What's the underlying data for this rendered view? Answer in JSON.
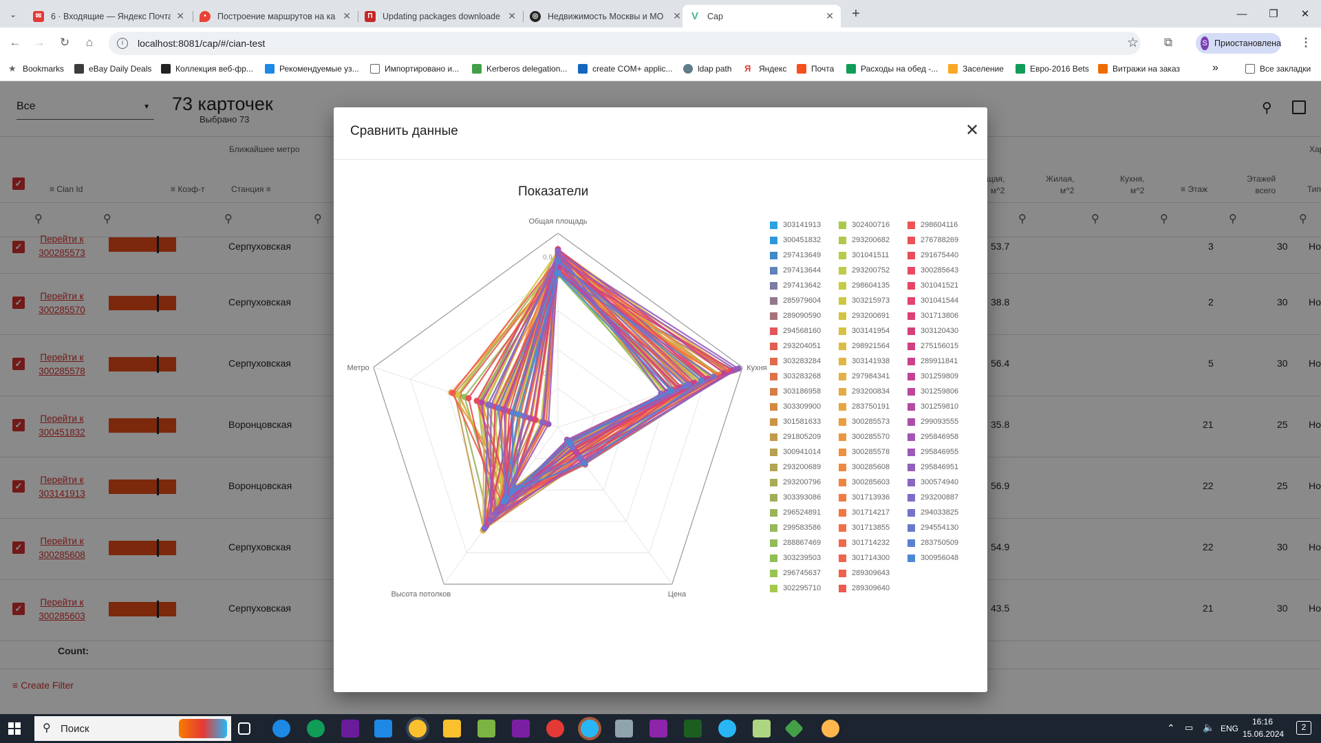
{
  "browser": {
    "tabs": [
      {
        "title": "6 · Входящие — Яндекс Почта",
        "icon": "mail-icon",
        "color": "#e53935"
      },
      {
        "title": "Построение маршрутов на ка",
        "icon": "map-pin-icon",
        "color": "#ea4335"
      },
      {
        "title": "Updating packages downloade",
        "icon": "page-icon",
        "color": "#c62828"
      },
      {
        "title": "Недвижимость Москвы и МО",
        "icon": "globe-icon",
        "color": "#222222"
      },
      {
        "title": "Cap",
        "icon": "vue-icon",
        "color": "#41b883"
      }
    ],
    "new_tab": "+",
    "url": "localhost:8081/cap/#/cian-test",
    "profile_initial": "S",
    "profile_label": "Приостановлена",
    "bookmarks": [
      {
        "label": "Bookmarks",
        "color": "#5f6368"
      },
      {
        "label": "eBay Daily Deals",
        "color": "#3c3c3c"
      },
      {
        "label": "Коллекция веб-фр...",
        "color": "#222222"
      },
      {
        "label": "Рекомендуемые уз...",
        "color": "#1e88e5"
      },
      {
        "label": "Импортировано и...",
        "color": "#5f6368"
      },
      {
        "label": "Kerberos delegation...",
        "color": "#43a047"
      },
      {
        "label": "create COM+ applic...",
        "color": "#1565c0"
      },
      {
        "label": "ldap path",
        "color": "#607d8b"
      },
      {
        "label": "Яндекс",
        "color": "#e53935"
      },
      {
        "label": "Почта",
        "color": "#f4511e"
      },
      {
        "label": "Расходы на обед -...",
        "color": "#0f9d58"
      },
      {
        "label": "Заселение",
        "color": "#f9a825"
      },
      {
        "label": "Евро-2016 Bets",
        "color": "#0f9d58"
      },
      {
        "label": "Витражи на заказ",
        "color": "#ef6c00"
      }
    ],
    "more_bookmarks": "»",
    "all_bookmarks": "Все закладки"
  },
  "app": {
    "filter_select": "Все",
    "cards_count": "73 карточек",
    "selected": "Выбрано 73",
    "group_header": "Ближайшее метро",
    "group_header_right": "Хар",
    "columns": {
      "cian_id": "Cian Id",
      "koef": "Коэф-т",
      "station": "Станция",
      "total": "щая,\nм^2",
      "living": "Жилая,\nм^2",
      "kitchen": "Кухня,\nм^2",
      "floor": "Этаж",
      "floors_total": "Этажей\nвсего",
      "type": "Тип"
    },
    "rows": [
      {
        "link_a": "Перейти к",
        "link_b": "300285573",
        "station": "Серпуховская",
        "total": "53.7",
        "floor": "3",
        "floors": "30",
        "type": "Ho"
      },
      {
        "link_a": "Перейти к",
        "link_b": "300285570",
        "station": "Серпуховская",
        "total": "38.8",
        "floor": "2",
        "floors": "30",
        "type": "Ho"
      },
      {
        "link_a": "Перейти к",
        "link_b": "300285578",
        "station": "Серпуховская",
        "total": "56.4",
        "floor": "5",
        "floors": "30",
        "type": "Ho"
      },
      {
        "link_a": "Перейти к",
        "link_b": "300451832",
        "station": "Воронцовская",
        "total": "35.8",
        "floor": "21",
        "floors": "25",
        "type": "Ho"
      },
      {
        "link_a": "Перейти к",
        "link_b": "303141913",
        "station": "Воронцовская",
        "total": "56.9",
        "floor": "22",
        "floors": "25",
        "type": "Ho"
      },
      {
        "link_a": "Перейти к",
        "link_b": "300285608",
        "station": "Серпуховская",
        "total": "54.9",
        "floor": "22",
        "floors": "30",
        "type": "Ho"
      },
      {
        "link_a": "Перейти к",
        "link_b": "300285603",
        "station": "Серпуховская",
        "total": "43.5",
        "floor": "21",
        "floors": "30",
        "type": "Ho"
      }
    ],
    "count_label": "Count:",
    "create_filter": "Create Filter"
  },
  "modal": {
    "title": "Сравнить данные",
    "close": "✕"
  },
  "chart_data": {
    "type": "radar",
    "title": "Показатели",
    "axes": [
      "Общая площадь",
      "Кухня",
      "Цена",
      "Высота потолков",
      "Метро"
    ],
    "ticks": [
      "0.9",
      "0.7",
      "0.6",
      "0.5"
    ],
    "legend": [
      {
        "name": "303141913",
        "color": "#2aa3e0"
      },
      {
        "name": "300451832",
        "color": "#2e97d8"
      },
      {
        "name": "297413649",
        "color": "#4189c8"
      },
      {
        "name": "297413644",
        "color": "#5f82b8"
      },
      {
        "name": "297413642",
        "color": "#7c7da4"
      },
      {
        "name": "285979604",
        "color": "#93778c"
      },
      {
        "name": "289090590",
        "color": "#a8727a"
      },
      {
        "name": "294568160",
        "color": "#e2555a"
      },
      {
        "name": "293204051",
        "color": "#e25f50"
      },
      {
        "name": "303283284",
        "color": "#e06a4c"
      },
      {
        "name": "303283268",
        "color": "#dc7449"
      },
      {
        "name": "303186958",
        "color": "#d97d47"
      },
      {
        "name": "303309900",
        "color": "#d28a42"
      },
      {
        "name": "301581633",
        "color": "#c99445"
      },
      {
        "name": "291805209",
        "color": "#c19b4a"
      },
      {
        "name": "300941014",
        "color": "#b8a04f"
      },
      {
        "name": "293200689",
        "color": "#b1a653"
      },
      {
        "name": "293200796",
        "color": "#a9ab57"
      },
      {
        "name": "303393086",
        "color": "#a0af59"
      },
      {
        "name": "296524891",
        "color": "#9ab45b"
      },
      {
        "name": "299583586",
        "color": "#98b85b"
      },
      {
        "name": "288867469",
        "color": "#94bb58"
      },
      {
        "name": "303239503",
        "color": "#92be56"
      },
      {
        "name": "296745637",
        "color": "#9ac350"
      },
      {
        "name": "302295710",
        "color": "#a2c84c"
      },
      {
        "name": "302400716",
        "color": "#a9c94a"
      },
      {
        "name": "293200682",
        "color": "#b0c948"
      },
      {
        "name": "301041511",
        "color": "#b8cb46"
      },
      {
        "name": "293200752",
        "color": "#bfcb44"
      },
      {
        "name": "298604135",
        "color": "#c6cb43"
      },
      {
        "name": "303215973",
        "color": "#ccc842"
      },
      {
        "name": "293200691",
        "color": "#d2c542"
      },
      {
        "name": "303141954",
        "color": "#d8c142"
      },
      {
        "name": "298921564",
        "color": "#dcbc42"
      },
      {
        "name": "303141938",
        "color": "#e0b641"
      },
      {
        "name": "297984341",
        "color": "#e3b041"
      },
      {
        "name": "293200834",
        "color": "#e5aa40"
      },
      {
        "name": "283750191",
        "color": "#e8a43f"
      },
      {
        "name": "300285573",
        "color": "#ea9e3e"
      },
      {
        "name": "300285570",
        "color": "#ec973e"
      },
      {
        "name": "300285578",
        "color": "#ee903e"
      },
      {
        "name": "300285608",
        "color": "#f0893f"
      },
      {
        "name": "300285603",
        "color": "#f1833f"
      },
      {
        "name": "301713936",
        "color": "#f27c40"
      },
      {
        "name": "301714217",
        "color": "#f27542"
      },
      {
        "name": "301713855",
        "color": "#f26f44"
      },
      {
        "name": "301714232",
        "color": "#f16946"
      },
      {
        "name": "301714300",
        "color": "#f06449"
      },
      {
        "name": "289309643",
        "color": "#ef5f4c"
      },
      {
        "name": "289309640",
        "color": "#ee5a4f"
      },
      {
        "name": "298604116",
        "color": "#ec5552"
      },
      {
        "name": "276788269",
        "color": "#eb5156"
      },
      {
        "name": "291675440",
        "color": "#e94d5a"
      },
      {
        "name": "300285643",
        "color": "#e8495f"
      },
      {
        "name": "301041521",
        "color": "#e54664"
      },
      {
        "name": "301041544",
        "color": "#e2436b"
      },
      {
        "name": "301713806",
        "color": "#dc4172"
      },
      {
        "name": "303120430",
        "color": "#d6407a"
      },
      {
        "name": "275156015",
        "color": "#d04083"
      },
      {
        "name": "289911841",
        "color": "#c9418c"
      },
      {
        "name": "301259809",
        "color": "#c24394"
      },
      {
        "name": "301259806",
        "color": "#bb469c"
      },
      {
        "name": "301259810",
        "color": "#b34aa4"
      },
      {
        "name": "299093555",
        "color": "#ab4fab"
      },
      {
        "name": "295846958",
        "color": "#a454b2"
      },
      {
        "name": "295846955",
        "color": "#9c59b8"
      },
      {
        "name": "295846951",
        "color": "#935fbd"
      },
      {
        "name": "300574940",
        "color": "#8a65c2"
      },
      {
        "name": "293200887",
        "color": "#806bc6"
      },
      {
        "name": "294033825",
        "color": "#7472ca"
      },
      {
        "name": "294554130",
        "color": "#6779ce"
      },
      {
        "name": "283750509",
        "color": "#5882d1"
      },
      {
        "name": "300956048",
        "color": "#4a8ad4"
      }
    ]
  },
  "taskbar": {
    "search_label": "Поиск",
    "lang": "ENG",
    "time": "16:16",
    "date": "15.06.2024",
    "notifications": "2"
  }
}
